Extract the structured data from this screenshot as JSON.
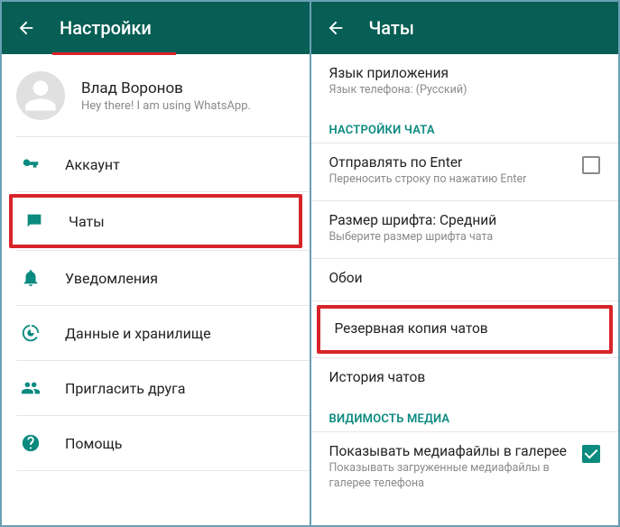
{
  "left": {
    "header_title": "Настройки",
    "profile": {
      "name": "Влад Воронов",
      "status": "Hey there! I am using WhatsApp."
    },
    "items": {
      "account": "Аккаунт",
      "chats": "Чаты",
      "notifications": "Уведомления",
      "data": "Данные и хранилище",
      "invite": "Пригласить друга",
      "help": "Помощь"
    }
  },
  "right": {
    "header_title": "Чаты",
    "app_lang": {
      "title": "Язык приложения",
      "sub": "Язык телефона: (Русский)"
    },
    "section_chat_settings": "НАСТРОЙКИ ЧАТА",
    "enter_send": {
      "title": "Отправлять по Enter",
      "sub": "Переносить строку по нажатию Enter"
    },
    "font_size": {
      "title": "Размер шрифта: Средний",
      "sub": "Выберите размер шрифта чата"
    },
    "wallpaper": "Обои",
    "backup": "Резервная копия чатов",
    "history": "История чатов",
    "section_media": "ВИДИМОСТЬ МЕДИА",
    "show_media": {
      "title": "Показывать медиафайлы в галерее",
      "sub": "Показывать загруженные медиафайлы в галерее телефона"
    }
  }
}
